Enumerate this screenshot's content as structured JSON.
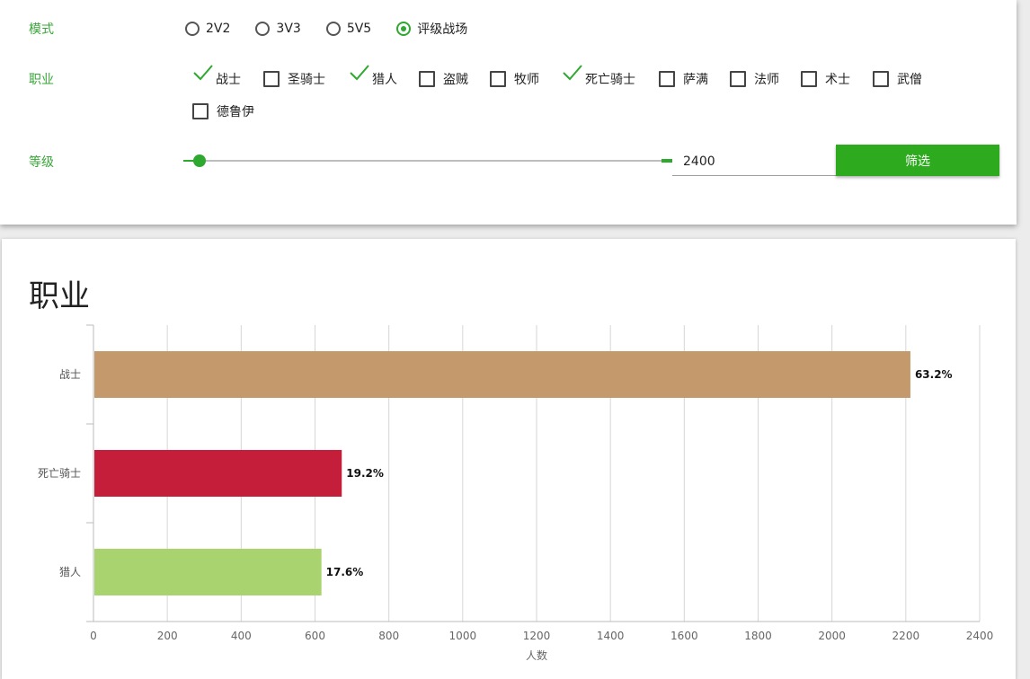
{
  "filters": {
    "mode_label": "模式",
    "modes": [
      {
        "label": "2V2",
        "selected": false
      },
      {
        "label": "3V3",
        "selected": false
      },
      {
        "label": "5V5",
        "selected": false
      },
      {
        "label": "评级战场",
        "selected": true
      }
    ],
    "class_label": "职业",
    "classes": [
      {
        "label": "战士",
        "checked": true
      },
      {
        "label": "圣骑士",
        "checked": false
      },
      {
        "label": "猎人",
        "checked": true
      },
      {
        "label": "盗贼",
        "checked": false
      },
      {
        "label": "牧师",
        "checked": false
      },
      {
        "label": "死亡骑士",
        "checked": true
      },
      {
        "label": "萨满",
        "checked": false
      },
      {
        "label": "法师",
        "checked": false
      },
      {
        "label": "术士",
        "checked": false
      },
      {
        "label": "武僧",
        "checked": false
      },
      {
        "label": "德鲁伊",
        "checked": false
      }
    ],
    "level_label": "等级",
    "level_value": "2400",
    "filter_button": "筛选",
    "accent_color": "#2eaa1f"
  },
  "chart_data": {
    "type": "bar",
    "orientation": "horizontal",
    "title": "职业",
    "categories": [
      "战士",
      "死亡骑士",
      "猎人"
    ],
    "values": [
      2210,
      670,
      615
    ],
    "data_labels": [
      "63.2%",
      "19.2%",
      "17.6%"
    ],
    "colors": [
      "#c49a6c",
      "#c41e3a",
      "#a9d36e"
    ],
    "xlabel": "人数",
    "xlim": [
      0,
      2400
    ],
    "xticks": [
      "0",
      "200",
      "400",
      "600",
      "800",
      "1000",
      "1200",
      "1400",
      "1600",
      "1800",
      "2000",
      "2200",
      "2400"
    ],
    "grid": true
  }
}
